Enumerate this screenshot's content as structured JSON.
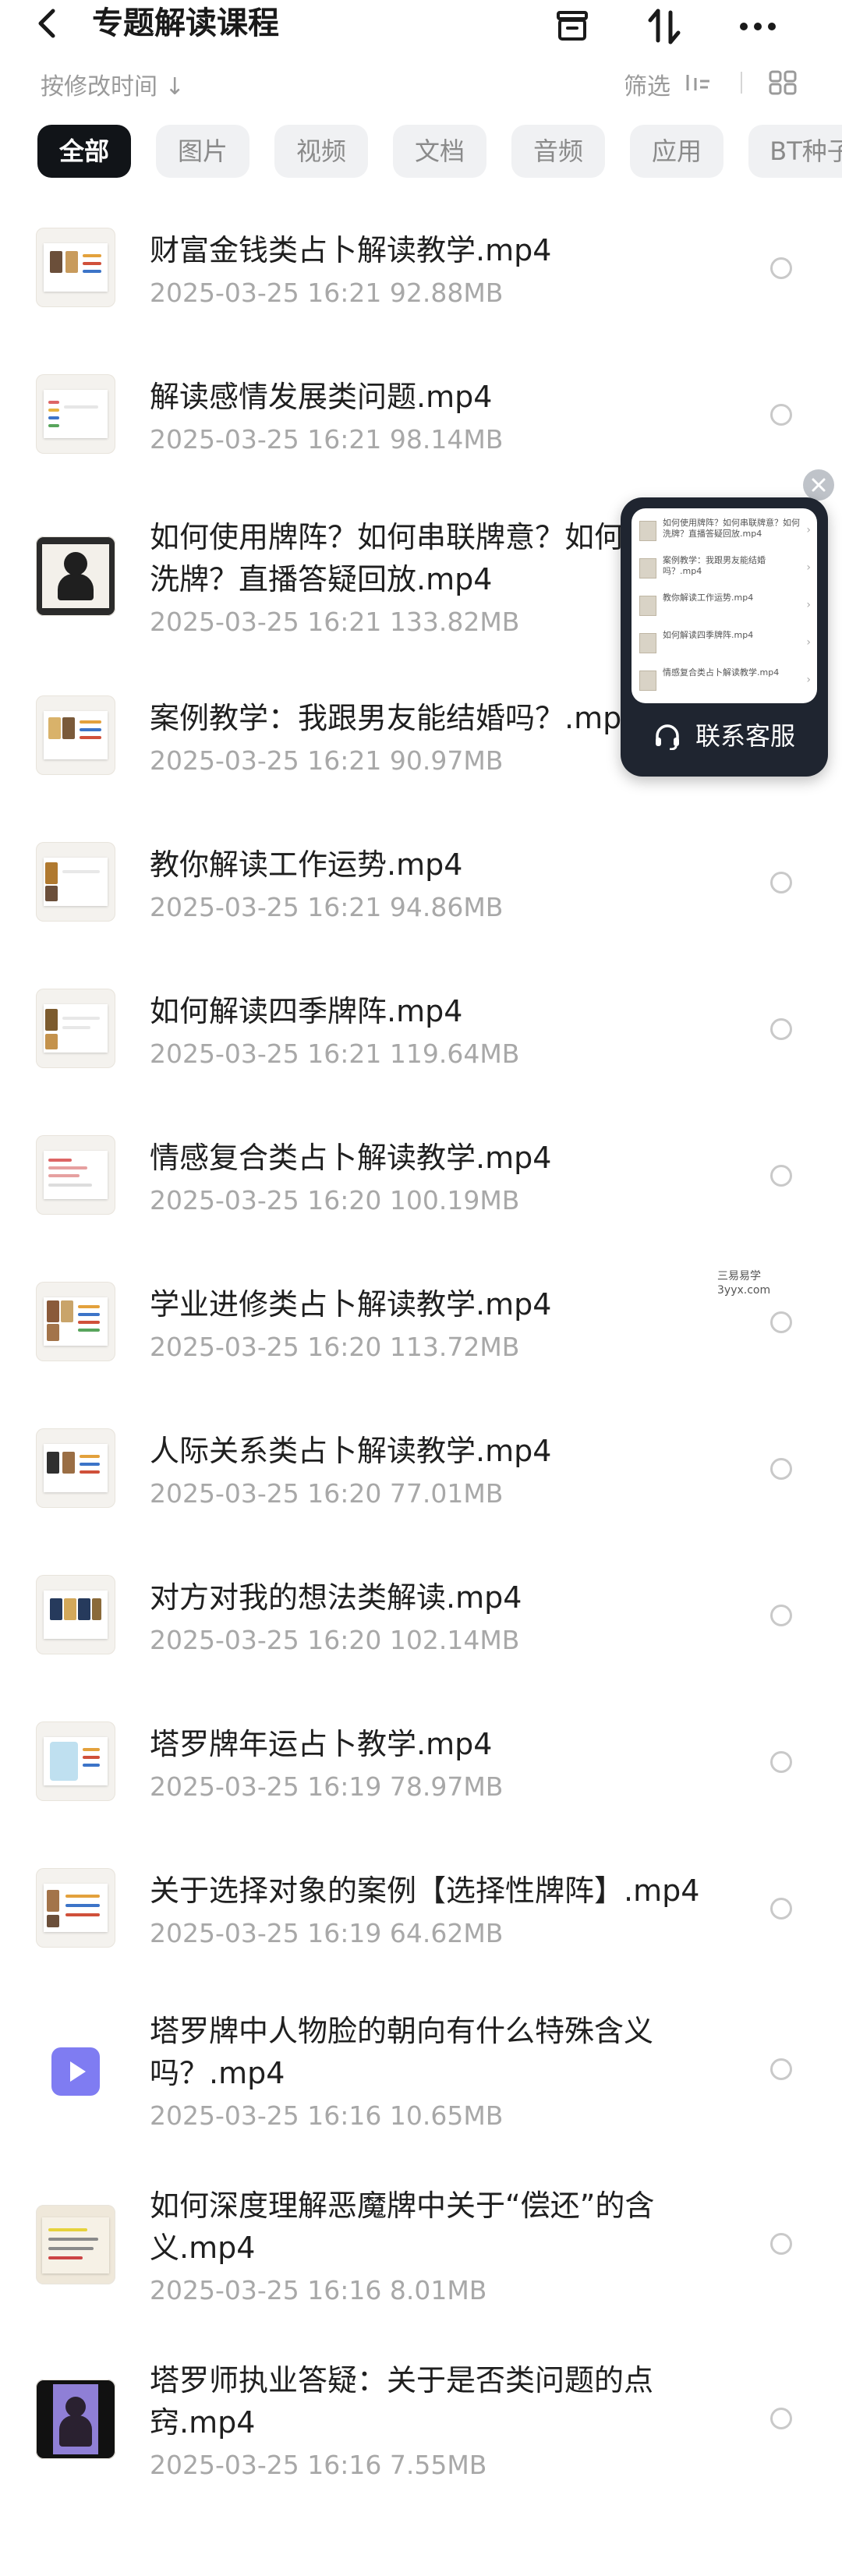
{
  "header": {
    "title": "专题解读课程"
  },
  "sort": {
    "label": "按修改时间 ↓",
    "filter_label": "筛选"
  },
  "chips": [
    {
      "label": "全部",
      "active": true
    },
    {
      "label": "图片",
      "active": false
    },
    {
      "label": "视频",
      "active": false
    },
    {
      "label": "文档",
      "active": false
    },
    {
      "label": "音频",
      "active": false
    },
    {
      "label": "应用",
      "active": false
    },
    {
      "label": "BT种子",
      "active": false
    }
  ],
  "files": [
    {
      "name": "财富金钱类占卜解读教学.mp4",
      "meta": "2025-03-25  16:21  92.88MB"
    },
    {
      "name": "解读感情发展类问题.mp4",
      "meta": "2025-03-25  16:21  98.14MB"
    },
    {
      "name_lines": [
        "如何使用牌阵？如何串联牌意？如何",
        "洗牌？直播答疑回放.mp4"
      ],
      "meta": "2025-03-25  16:21  133.82MB"
    },
    {
      "name": "案例教学：我跟男友能结婚吗？.mp4",
      "meta": "2025-03-25  16:21  90.97MB"
    },
    {
      "name": "教你解读工作运势.mp4",
      "meta": "2025-03-25  16:21  94.86MB"
    },
    {
      "name": "如何解读四季牌阵.mp4",
      "meta": "2025-03-25  16:21  119.64MB"
    },
    {
      "name": "情感复合类占卜解读教学.mp4",
      "meta": "2025-03-25  16:20  100.19MB"
    },
    {
      "name": "学业进修类占卜解读教学.mp4",
      "meta": "2025-03-25  16:20  113.72MB"
    },
    {
      "name": "人际关系类占卜解读教学.mp4",
      "meta": "2025-03-25  16:20  77.01MB"
    },
    {
      "name": "对方对我的想法类解读.mp4",
      "meta": "2025-03-25  16:20  102.14MB"
    },
    {
      "name": "塔罗牌年运占卜教学.mp4",
      "meta": "2025-03-25  16:19  78.97MB"
    },
    {
      "name": "关于选择对象的案例【选择性牌阵】.mp4",
      "meta": "2025-03-25  16:19  64.62MB"
    },
    {
      "name_lines": [
        "塔罗牌中人物脸的朝向有什么特殊含义",
        "吗？.mp4"
      ],
      "meta": "2025-03-25  16:16  10.65MB"
    },
    {
      "name_lines": [
        "如何深度理解恶魔牌中关于“偿还”的含",
        "义.mp4"
      ],
      "meta": "2025-03-25  16:16  8.01MB"
    },
    {
      "name_lines": [
        "塔罗师执业答疑：关于是否类问题的点",
        "窍.mp4"
      ],
      "meta": "2025-03-25  16:16  7.55MB"
    }
  ],
  "float_widget": {
    "label": "联系客服",
    "preview_items": [
      "如何使用牌阵？如何串联牌意？如何洗牌？直播答疑回放.mp4",
      "案例教学：我跟男友能结婚吗？.mp4",
      "教你解读工作运势.mp4",
      "如何解读四季牌阵.mp4",
      "情感复合类占卜解读教学.mp4"
    ]
  },
  "watermark": {
    "line1": "三易易学",
    "line2": "3yyx.com"
  },
  "colors": {
    "chip_active_bg": "#111418",
    "chip_bg": "#f0f1f3",
    "meta_text": "#a8a8a8",
    "float_bg": "#1f2530"
  }
}
